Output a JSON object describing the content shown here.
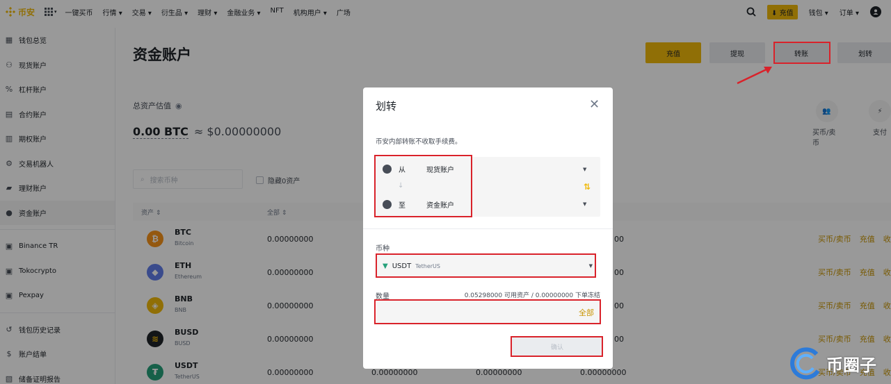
{
  "nav": {
    "logo": "币安",
    "links": [
      "一键买币",
      "行情 ▾",
      "交易 ▾",
      "衍生品 ▾",
      "理财 ▾",
      "金融业务 ▾",
      "NFT",
      "机构用户 ▾",
      "广场"
    ],
    "deposit": "充值",
    "wallet": "钱包 ▾",
    "orders": "订单 ▾"
  },
  "sidebar": {
    "items": [
      {
        "label": "钱包总览",
        "icon": "grid-icon"
      },
      {
        "label": "现货账户",
        "icon": "spot-icon"
      },
      {
        "label": "杠杆账户",
        "icon": "margin-icon"
      },
      {
        "label": "合约账户",
        "icon": "futures-icon"
      },
      {
        "label": "期权账户",
        "icon": "options-icon"
      },
      {
        "label": "交易机器人",
        "icon": "robot-icon"
      },
      {
        "label": "理财账户",
        "icon": "earn-icon"
      },
      {
        "label": "资金账户",
        "icon": "funding-icon"
      }
    ],
    "items2": [
      {
        "label": "Binance TR",
        "icon": "wallet-icon"
      },
      {
        "label": "Tokocrypto",
        "icon": "wallet-icon"
      },
      {
        "label": "Pexpay",
        "icon": "wallet-icon"
      }
    ],
    "items3": [
      {
        "label": "钱包历史记录",
        "icon": "history-icon"
      },
      {
        "label": "账户结单",
        "icon": "statement-icon"
      },
      {
        "label": "储备证明报告",
        "icon": "report-icon"
      }
    ]
  },
  "main": {
    "title": "资金账户",
    "buttons": {
      "deposit": "充值",
      "withdraw": "提现",
      "transfer": "转账",
      "convert": "划转"
    },
    "est_label": "总资产估值",
    "est_btc": "0.00 BTC",
    "est_fiat": "≈ $0.00000000",
    "quick": [
      {
        "label": "买币/卖币"
      },
      {
        "label": "支付"
      }
    ],
    "search_placeholder": "搜索币种",
    "hide_zero": "隐藏0资产",
    "col_asset": "资产 ⇕",
    "col_total": "全部 ⇕",
    "rows": [
      {
        "symbol": "BTC",
        "name": "Bitcoin",
        "color": "#f7931a",
        "glyph": "₿",
        "total": "0.00000000",
        "v2": "",
        "v3": "",
        "v4": "00"
      },
      {
        "symbol": "ETH",
        "name": "Ethereum",
        "color": "#627eea",
        "glyph": "◆",
        "total": "0.00000000",
        "v2": "",
        "v3": "",
        "v4": "00"
      },
      {
        "symbol": "BNB",
        "name": "BNB",
        "color": "#f0b90b",
        "glyph": "◈",
        "total": "0.00000000",
        "v2": "",
        "v3": "",
        "v4": "00"
      },
      {
        "symbol": "BUSD",
        "name": "BUSD",
        "color": "#1e2329",
        "glyph": "≋",
        "total": "0.00000000",
        "v2": "",
        "v3": "",
        "v4": "00"
      },
      {
        "symbol": "USDT",
        "name": "TetherUS",
        "color": "#26a17b",
        "glyph": "₮",
        "total": "0.00000000",
        "v2": "0.00000000",
        "v3": "0.00000000",
        "v4": "0.00000000"
      }
    ],
    "row_actions": [
      "买币/卖币",
      "充值",
      "收"
    ]
  },
  "modal": {
    "title": "划转",
    "note": "币安内部转账不收取手续费。",
    "from_label": "从",
    "from_value": "现货账户",
    "to_label": "至",
    "to_value": "资金账户",
    "coin_label": "币种",
    "coin_symbol": "USDT",
    "coin_name": "TetherUS",
    "amount_label": "数量",
    "amount_avail": "0.05298000 可用资产 / 0.00000000 下单冻结",
    "all_button": "全部",
    "confirm": "确认"
  },
  "watermark": "币圈子"
}
